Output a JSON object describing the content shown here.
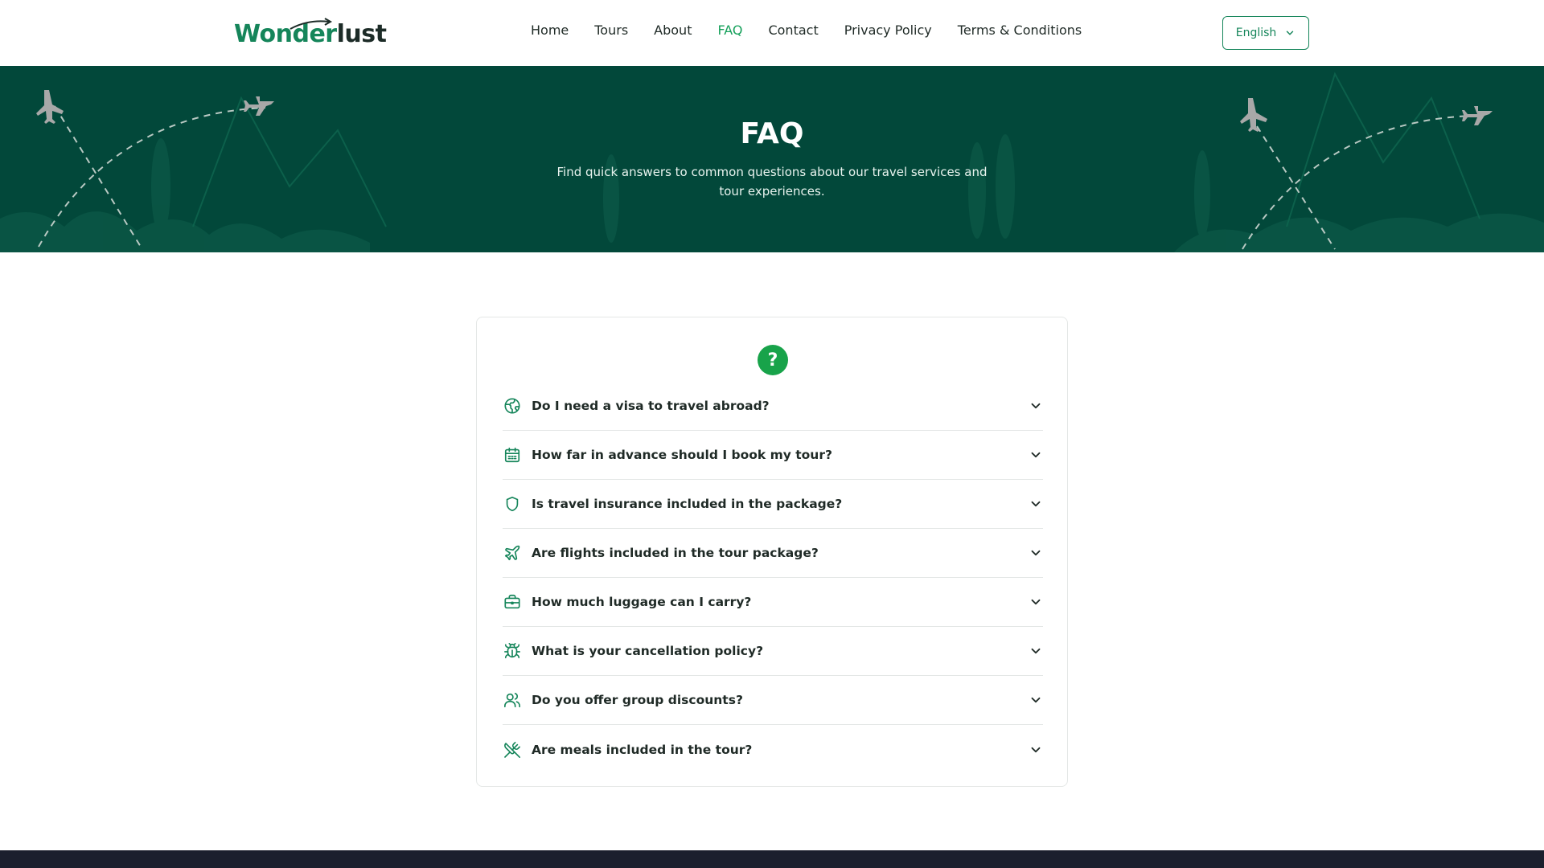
{
  "brand": {
    "logo_part1": "Wonder",
    "logo_part2": "lust"
  },
  "nav": {
    "items": [
      {
        "label": "Home",
        "active": false
      },
      {
        "label": "Tours",
        "active": false
      },
      {
        "label": "About",
        "active": false
      },
      {
        "label": "FAQ",
        "active": true
      },
      {
        "label": "Contact",
        "active": false
      },
      {
        "label": "Privacy Policy",
        "active": false
      },
      {
        "label": "Terms & Conditions",
        "active": false
      }
    ]
  },
  "language": {
    "selected": "English",
    "icon": "chevron-down-icon"
  },
  "hero": {
    "title": "FAQ",
    "subtitle": "Find quick answers to common questions about our travel services and tour experiences."
  },
  "faq": {
    "header_icon": "question-circle-icon",
    "items": [
      {
        "question": "Do I need a visa to travel abroad?",
        "icon": "globe-icon"
      },
      {
        "question": "How far in advance should I book my tour?",
        "icon": "calendar-icon"
      },
      {
        "question": "Is travel insurance included in the package?",
        "icon": "shield-icon"
      },
      {
        "question": "Are flights included in the tour package?",
        "icon": "plane-icon"
      },
      {
        "question": "How much luggage can I carry?",
        "icon": "briefcase-icon"
      },
      {
        "question": "What is your cancellation policy?",
        "icon": "bug-icon"
      },
      {
        "question": "Do you offer group discounts?",
        "icon": "users-icon"
      },
      {
        "question": "Are meals included in the tour?",
        "icon": "utensils-crossed-icon"
      }
    ]
  },
  "colors": {
    "brand_green": "#15855a",
    "active_nav": "#15a05a",
    "hero_bg": "#02483a",
    "accent_badge": "#18a34a",
    "footer_bg": "#1b1f2e"
  }
}
